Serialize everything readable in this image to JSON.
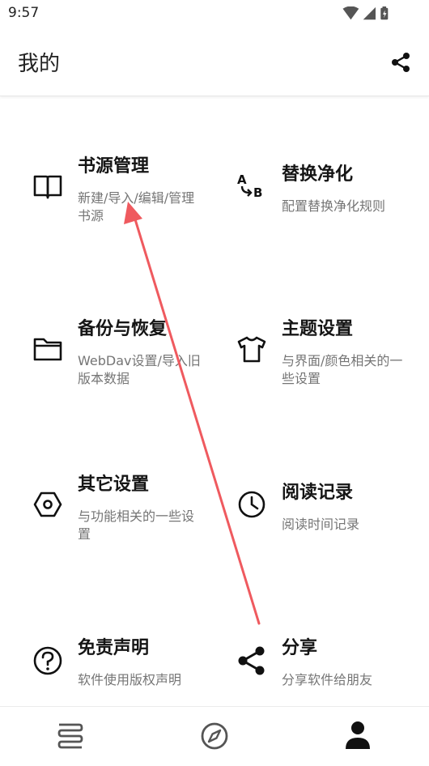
{
  "status_bar": {
    "time": "9:57"
  },
  "app_bar": {
    "title": "我的"
  },
  "cards": [
    {
      "name": "书源管理",
      "desc": "新建/导入/编辑/管理书源",
      "icon": "book-icon"
    },
    {
      "name": "替换净化",
      "desc": "配置替换净化规则",
      "icon": "replace-ab-icon"
    },
    {
      "name": "备份与恢复",
      "desc": "WebDav设置/导入旧版本数据",
      "icon": "folder-icon"
    },
    {
      "name": "主题设置",
      "desc": "与界面/颜色相关的一些设置",
      "icon": "tshirt-icon"
    },
    {
      "name": "其它设置",
      "desc": "与功能相关的一些设置",
      "icon": "hex-settings-icon"
    },
    {
      "name": "阅读记录",
      "desc": "阅读时间记录",
      "icon": "clock-icon"
    },
    {
      "name": "免责声明",
      "desc": "软件使用版权声明",
      "icon": "question-icon"
    },
    {
      "name": "分享",
      "desc": "分享软件给朋友",
      "icon": "share-icon"
    }
  ],
  "bottom_nav": [
    {
      "icon": "bookshelf-icon",
      "active": false
    },
    {
      "icon": "compass-icon",
      "active": false
    },
    {
      "icon": "person-icon",
      "active": true
    }
  ],
  "annotation": {
    "color": "#ef5a5f"
  }
}
